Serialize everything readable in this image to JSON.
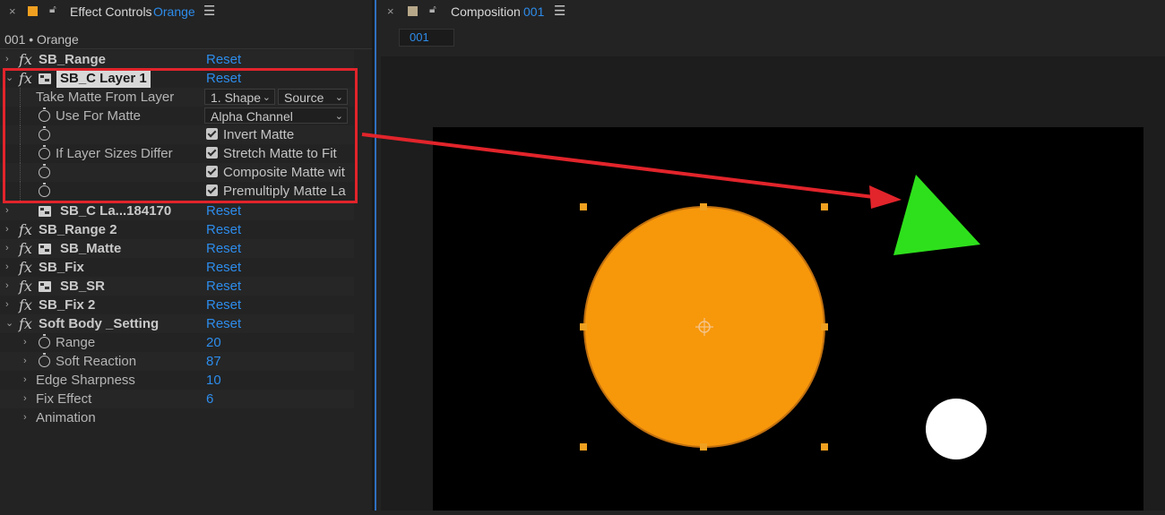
{
  "effect_controls": {
    "title": "Effect Controls",
    "layer": "Orange",
    "close_glyph": "×",
    "menu_glyph": "☰",
    "swatch_color": "#f0a020",
    "breadcrumb": "001 • Orange",
    "reset_label": "Reset",
    "effects": [
      {
        "name": "SB_Range"
      },
      {
        "name": "SB_C Layer 1",
        "selected": true
      },
      {
        "name": "SB_C La...184170"
      },
      {
        "name": "SB_Range 2"
      },
      {
        "name": "SB_Matte"
      },
      {
        "name": "SB_Fix"
      },
      {
        "name": "SB_SR"
      },
      {
        "name": "SB_Fix 2"
      },
      {
        "name": "Soft Body _Setting"
      }
    ],
    "c_layer_props": {
      "take_matte_label": "Take Matte From Layer",
      "take_matte_value": "1. Shape",
      "take_matte_source": "Source",
      "use_for_matte_label": "Use For Matte",
      "use_for_matte_value": "Alpha Channel",
      "invert_matte": "Invert Matte",
      "if_layer_sizes_label": "If Layer Sizes Differ",
      "stretch_matte": "Stretch Matte to Fit",
      "composite_matte": "Composite Matte wit",
      "premultiply_matte": "Premultiply Matte La"
    },
    "settings": [
      {
        "label": "Range",
        "value": "20"
      },
      {
        "label": "Soft Reaction",
        "value": "87"
      },
      {
        "label": "Edge Sharpness",
        "value": "10"
      },
      {
        "label": "Fix Effect",
        "value": "6"
      },
      {
        "label": "Animation",
        "value": ""
      }
    ]
  },
  "composition": {
    "title": "Composition",
    "name": "001",
    "tab_label": "001",
    "close_glyph": "×",
    "menu_glyph": "☰",
    "swatch_color": "#b8a88a",
    "shapes": {
      "circle_color": "#f7970a",
      "triangle_color": "#2ee01c",
      "small_circle_color": "#ffffff",
      "handle_color": "#f0a020"
    }
  },
  "annotation": {
    "color": "#e2242b"
  }
}
